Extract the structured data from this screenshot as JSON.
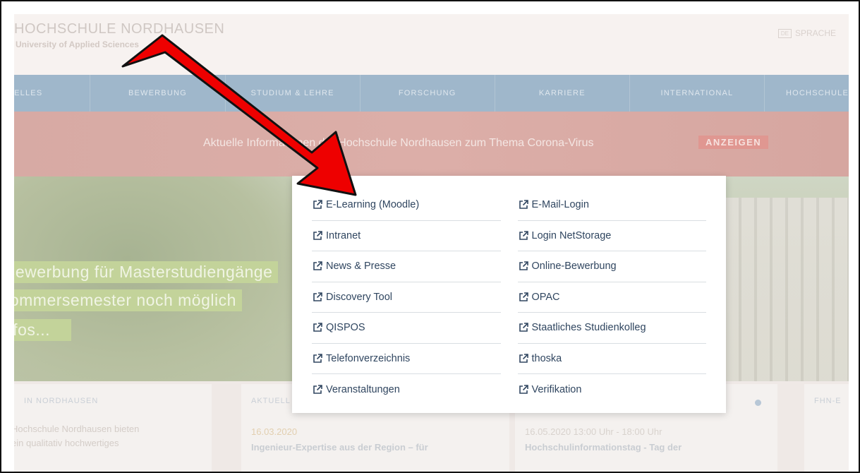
{
  "header": {
    "logo_main": "HOCHSCHULE NORDHAUSEN",
    "logo_sub": "University of Applied Sciences",
    "lang_badge": "DE",
    "lang_label": "SPRACHE"
  },
  "nav": {
    "items": [
      "AKTUELLES",
      "BEWERBUNG",
      "STUDIUM & LEHRE",
      "FORSCHUNG",
      "KARRIERE",
      "INTERNATIONAL",
      "HOCHSCHULE"
    ]
  },
  "banner": {
    "text": "Aktuelle Informationen der Hochschule Nordhausen zum Thema Corona-Virus",
    "button": "ANZEIGEN"
  },
  "hero": {
    "lines": [
      "Bewerbung für Masterstudiengänge",
      "Sommersemester noch möglich",
      "Infos..."
    ]
  },
  "cards": {
    "card1": {
      "title": "IN NORDHAUSEN",
      "body1": "Hochschule Nordhausen bieten",
      "body2": "ein qualitativ hochwertiges"
    },
    "card2": {
      "title": "AKTUELL",
      "date": "16.03.2020",
      "text": "Ingenieur-Expertise aus der Region – für"
    },
    "card3": {
      "date": "16.05.2020 13:00 Uhr - 18:00 Uhr",
      "text": "Hochschulinformationstag - Tag der"
    },
    "card4": {
      "title": "FHN-E"
    }
  },
  "dropdown": {
    "left": [
      "E-Learning (Moodle)",
      "Intranet",
      "News & Presse",
      "Discovery Tool",
      "QISPOS",
      "Telefonverzeichnis",
      "Veranstaltungen"
    ],
    "right": [
      "E-Mail-Login",
      "Login NetStorage",
      "Online-Bewerbung",
      "OPAC",
      "Staatliches Studienkolleg",
      "thoska",
      "Verifikation"
    ]
  },
  "colors": {
    "arrow": "#ee0000",
    "link": "#304660",
    "nav": "#9fb7cb",
    "banner": "#d7aaa4"
  },
  "icons": {
    "link_icon": "external-link-icon",
    "arrow": "red-arrow-annotation"
  }
}
